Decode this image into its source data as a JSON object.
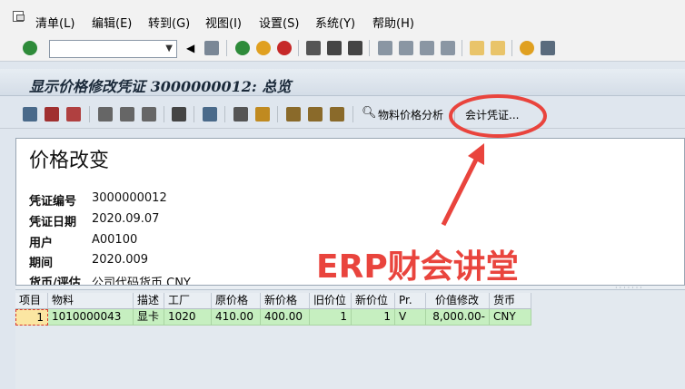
{
  "menu": {
    "items": [
      "清单(L)",
      "编辑(E)",
      "转到(G)",
      "视图(I)",
      "设置(S)",
      "系统(Y)",
      "帮助(H)"
    ]
  },
  "toolbar": {
    "command_value": ""
  },
  "title": "显示价格修改凭证 3000000012: 总览",
  "app_toolbar": {
    "material_price_analysis": "物料价格分析",
    "accounting_documents": "会计凭证..."
  },
  "header": {
    "heading": "价格改变",
    "fields": [
      {
        "label": "凭证编号",
        "value": "3000000012"
      },
      {
        "label": "凭证日期",
        "value": "2020.09.07"
      },
      {
        "label": "用户",
        "value": "A00100"
      },
      {
        "label": "期间",
        "value": "2020.009"
      },
      {
        "label": "货币/评估",
        "value": "公司代码货币 CNY"
      }
    ]
  },
  "grid": {
    "columns": [
      "项目",
      "物料",
      "描述",
      "工厂",
      "原价格",
      "新价格",
      "旧价位",
      "新价位",
      "Pr.",
      "价值修改",
      "货币"
    ],
    "rows": [
      [
        "1",
        "1010000043",
        "显卡",
        "1020",
        "410.00",
        "400.00",
        "1",
        "1",
        "V",
        "8,000.00-",
        "CNY"
      ]
    ]
  },
  "watermark": "ERP财会讲堂",
  "colors": {
    "annotation_red": "#e9443d",
    "row_green": "#c6efc0"
  }
}
